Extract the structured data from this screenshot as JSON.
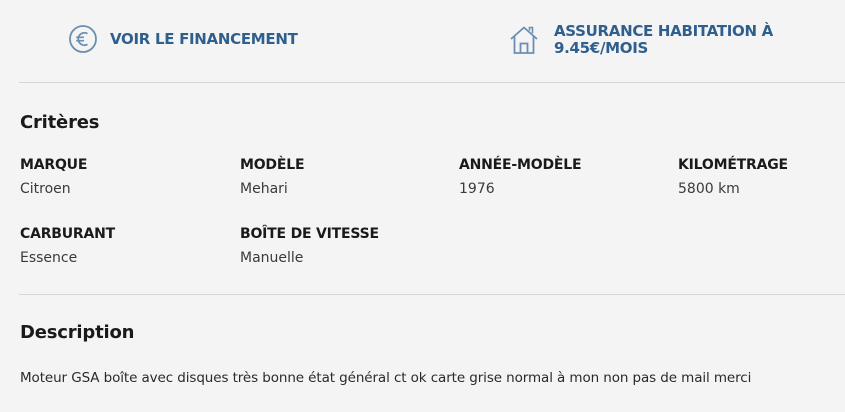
{
  "promos": {
    "financement": {
      "label": "VOIR LE FINANCEMENT",
      "icon": "euro-circle-icon"
    },
    "assurance": {
      "line1": "ASSURANCE HABITATION À",
      "line2": "9.45€/MOIS",
      "icon": "house-icon"
    }
  },
  "criteres": {
    "title": "Critères",
    "items": [
      {
        "label": "MARQUE",
        "value": "Citroen"
      },
      {
        "label": "MODÈLE",
        "value": "Mehari"
      },
      {
        "label": "ANNÉE-MODÈLE",
        "value": "1976"
      },
      {
        "label": "KILOMÉTRAGE",
        "value": "5800 km"
      },
      {
        "label": "CARBURANT",
        "value": "Essence"
      },
      {
        "label": "BOÎTE DE VITESSE",
        "value": "Manuelle"
      }
    ]
  },
  "description": {
    "title": "Description",
    "text": "Moteur GSA boîte avec disques très bonne état général ct ok carte grise normal à mon non pas de mail merci"
  },
  "colors": {
    "accent": "#2f5f8c",
    "icon": "#6b8fb3",
    "background": "#f4f4f4",
    "divider": "#d6d6d6"
  }
}
